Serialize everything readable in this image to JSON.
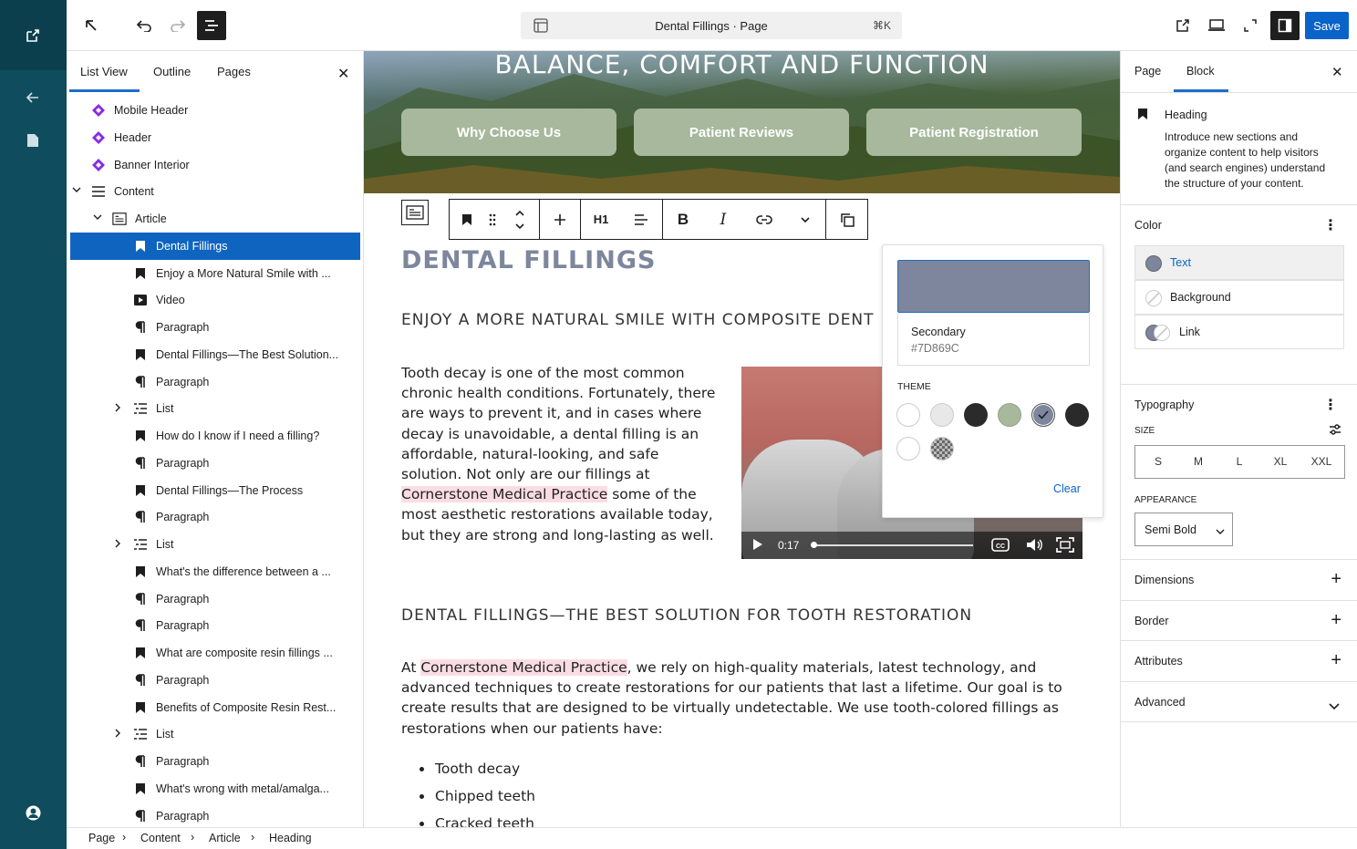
{
  "document": {
    "title": "Dental Fillings · Page",
    "shortcut": "⌘K"
  },
  "toolbar": {
    "save_label": "Save"
  },
  "left_panel": {
    "tabs": [
      "List View",
      "Outline",
      "Pages"
    ],
    "items": [
      {
        "label": "Mobile Header",
        "icon": "template-part-icon",
        "level": 0
      },
      {
        "label": "Header",
        "icon": "template-part-icon",
        "level": 0
      },
      {
        "label": "Banner Interior",
        "icon": "template-part-icon",
        "level": 0
      },
      {
        "label": "Content",
        "icon": "post-content-icon",
        "level": 0,
        "expanded": true
      },
      {
        "label": "Article",
        "icon": "group-icon",
        "level": 1,
        "expanded": true
      },
      {
        "label": "Dental Fillings",
        "icon": "heading-icon",
        "level": 2,
        "selected": true
      },
      {
        "label": "Enjoy a More Natural Smile with ...",
        "icon": "heading-icon",
        "level": 2
      },
      {
        "label": "Video",
        "icon": "video-icon",
        "level": 2
      },
      {
        "label": "Paragraph",
        "icon": "paragraph-icon",
        "level": 2
      },
      {
        "label": "Dental Fillings—The Best Solution...",
        "icon": "heading-icon",
        "level": 2
      },
      {
        "label": "Paragraph",
        "icon": "paragraph-icon",
        "level": 2
      },
      {
        "label": "List",
        "icon": "list-icon",
        "level": 2,
        "collapsible": true
      },
      {
        "label": "How do I know if I need a filling?",
        "icon": "heading-icon",
        "level": 2
      },
      {
        "label": "Paragraph",
        "icon": "paragraph-icon",
        "level": 2
      },
      {
        "label": "Dental Fillings—The Process",
        "icon": "heading-icon",
        "level": 2
      },
      {
        "label": "Paragraph",
        "icon": "paragraph-icon",
        "level": 2
      },
      {
        "label": "List",
        "icon": "list-icon",
        "level": 2,
        "collapsible": true
      },
      {
        "label": "What's the difference between a ...",
        "icon": "heading-icon",
        "level": 2
      },
      {
        "label": "Paragraph",
        "icon": "paragraph-icon",
        "level": 2
      },
      {
        "label": "Paragraph",
        "icon": "paragraph-icon",
        "level": 2
      },
      {
        "label": "What are composite resin fillings ...",
        "icon": "heading-icon",
        "level": 2
      },
      {
        "label": "Paragraph",
        "icon": "paragraph-icon",
        "level": 2
      },
      {
        "label": "Benefits of Composite Resin Rest...",
        "icon": "heading-icon",
        "level": 2
      },
      {
        "label": "List",
        "icon": "list-icon",
        "level": 2,
        "collapsible": true
      },
      {
        "label": "Paragraph",
        "icon": "paragraph-icon",
        "level": 2
      },
      {
        "label": "What's wrong with metal/amalga...",
        "icon": "heading-icon",
        "level": 2
      },
      {
        "label": "Paragraph",
        "icon": "paragraph-icon",
        "level": 2
      }
    ]
  },
  "canvas": {
    "banner_title": "BALANCE, COMFORT AND FUNCTION",
    "banner_buttons": [
      "Why Choose Us",
      "Patient Reviews",
      "Patient Registration"
    ],
    "block_toolbar": {
      "heading_level": "H1"
    },
    "heading": "DENTAL FILLINGS",
    "subheading": "ENJOY A MORE NATURAL SMILE WITH COMPOSITE DENT",
    "para1_a": "Tooth decay is one of the most common chronic health conditions. Fortunately, there are ways to prevent it, and in cases where decay is unavoidable, a dental filling is an affordable, natural-looking, and safe solution. Not only are our fillings at ",
    "para1_highlight": "Cornerstone Medical Practice",
    "para1_b": " some of the most aesthetic restorations available today, but they are strong and long-lasting as well.",
    "video_time": "0:17",
    "heading2": "DENTAL FILLINGS—THE BEST SOLUTION FOR TOOTH RESTORATION",
    "para2_a": "At ",
    "para2_highlight": "Cornerstone Medical Practice",
    "para2_b": ", we rely on high-quality materials, latest technology, and advanced techniques to create restorations for our patients that last a lifetime. Our goal is to create results that are designed to be virtually undetectable. We use tooth-colored fillings as restorations when our patients have:",
    "list": [
      "Tooth decay",
      "Chipped teeth",
      "Cracked teeth"
    ]
  },
  "color_popover": {
    "selected_name": "Secondary",
    "selected_hex": "#7D869C",
    "theme_label": "THEME",
    "clear_label": "Clear",
    "theme_colors": [
      "#ffffff",
      "#e8e8e8",
      "#2b2b2b",
      "#a7b89c",
      "#7d869c",
      "#2a2a2a",
      "#ffffff",
      "checkered"
    ]
  },
  "inspector": {
    "tabs": [
      "Page",
      "Block"
    ],
    "block_name": "Heading",
    "block_desc": "Introduce new sections and organize content to help visitors (and search engines) understand the structure of your content.",
    "color_title": "Color",
    "color_items": [
      "Text",
      "Background",
      "Link"
    ],
    "typography_title": "Typography",
    "size_label": "SIZE",
    "sizes": [
      "S",
      "M",
      "L",
      "XL",
      "XXL"
    ],
    "appearance_label": "APPEARANCE",
    "appearance_value": "Semi Bold",
    "panels": [
      "Dimensions",
      "Border",
      "Attributes",
      "Advanced"
    ]
  },
  "breadcrumb": [
    "Page",
    "Content",
    "Article",
    "Heading"
  ],
  "colors": {
    "accent": "#0a63c8",
    "rail": "#0f4d5e",
    "heading": "#7d869c",
    "button_green": "#a7b89c"
  }
}
